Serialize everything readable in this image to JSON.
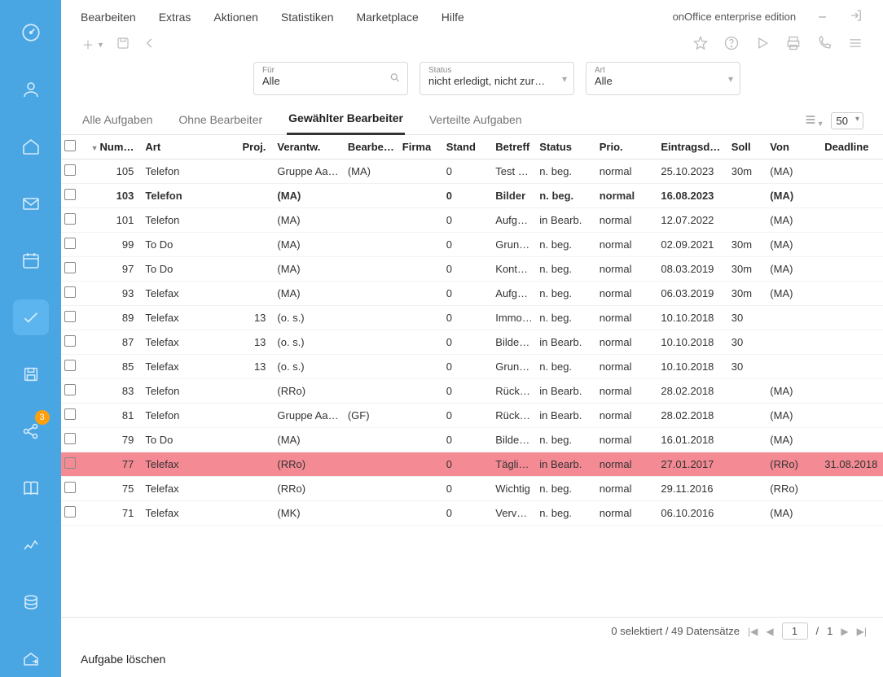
{
  "sidebar": {
    "badge": "3"
  },
  "menubar": {
    "items": [
      "Bearbeiten",
      "Extras",
      "Aktionen",
      "Statistiken",
      "Marketplace",
      "Hilfe"
    ],
    "edition": "onOffice enterprise edition",
    "minimize": "–"
  },
  "filters": {
    "fuer": {
      "label": "Für",
      "value": "Alle"
    },
    "status": {
      "label": "Status",
      "value": "nicht erledigt, nicht zurü…"
    },
    "art": {
      "label": "Art",
      "value": "Alle"
    }
  },
  "tabs": {
    "items": [
      "Alle Aufgaben",
      "Ohne Bearbeiter",
      "Gewählter Bearbeiter",
      "Verteilte Aufgaben"
    ],
    "active": 2,
    "page_size": "50"
  },
  "headers": {
    "num": "Num…",
    "art": "Art",
    "proj": "Proj.",
    "verantw": "Verantw.",
    "bearbei": "Bearbei…",
    "firma": "Firma",
    "stand": "Stand",
    "betreff": "Betreff",
    "status": "Status",
    "prio": "Prio.",
    "eintrag": "Eintragsd…",
    "soll": "Soll",
    "von": "Von",
    "deadline": "Deadline"
  },
  "rows": [
    {
      "num": "105",
      "art": "Telefon",
      "proj": "",
      "ver": "Gruppe Aa…",
      "bearb": "(MA)",
      "firma": "",
      "stand": "0",
      "betr": "Test …",
      "status": "n. beg.",
      "prio": "normal",
      "eint": "25.10.2023",
      "soll": "30m",
      "von": "(MA)",
      "dead": "",
      "bold": false,
      "hl": false
    },
    {
      "num": "103",
      "art": "Telefon",
      "proj": "",
      "ver": "(MA)",
      "bearb": "",
      "firma": "",
      "stand": "0",
      "betr": "Bilder",
      "status": "n. beg.",
      "prio": "normal",
      "eint": "16.08.2023",
      "soll": "",
      "von": "(MA)",
      "dead": "",
      "bold": true,
      "hl": false
    },
    {
      "num": "101",
      "art": "Telefon",
      "proj": "",
      "ver": "(MA)",
      "bearb": "",
      "firma": "",
      "stand": "0",
      "betr": "Aufga…",
      "status": "in Bearb.",
      "prio": "normal",
      "eint": "12.07.2022",
      "soll": "",
      "von": "(MA)",
      "dead": "",
      "bold": false,
      "hl": false
    },
    {
      "num": "99",
      "art": "To Do",
      "proj": "",
      "ver": "(MA)",
      "bearb": "",
      "firma": "",
      "stand": "0",
      "betr": "Grun…",
      "status": "n. beg.",
      "prio": "normal",
      "eint": "02.09.2021",
      "soll": "30m",
      "von": "(MA)",
      "dead": "",
      "bold": false,
      "hl": false
    },
    {
      "num": "97",
      "art": "To Do",
      "proj": "",
      "ver": "(MA)",
      "bearb": "",
      "firma": "",
      "stand": "0",
      "betr": "Konta…",
      "status": "n. beg.",
      "prio": "normal",
      "eint": "08.03.2019",
      "soll": "30m",
      "von": "(MA)",
      "dead": "",
      "bold": false,
      "hl": false
    },
    {
      "num": "93",
      "art": "Telefax",
      "proj": "",
      "ver": "(MA)",
      "bearb": "",
      "firma": "",
      "stand": "0",
      "betr": "Aufga…",
      "status": "n. beg.",
      "prio": "normal",
      "eint": "06.03.2019",
      "soll": "30m",
      "von": "(MA)",
      "dead": "",
      "bold": false,
      "hl": false
    },
    {
      "num": "89",
      "art": "Telefax",
      "proj": "13",
      "ver": "(o. s.)",
      "bearb": "",
      "firma": "",
      "stand": "0",
      "betr": "Immo…",
      "status": "n. beg.",
      "prio": "normal",
      "eint": "10.10.2018",
      "soll": "30",
      "von": "",
      "dead": "",
      "bold": false,
      "hl": false
    },
    {
      "num": "87",
      "art": "Telefax",
      "proj": "13",
      "ver": "(o. s.)",
      "bearb": "",
      "firma": "",
      "stand": "0",
      "betr": "Bilder…",
      "status": "in Bearb.",
      "prio": "normal",
      "eint": "10.10.2018",
      "soll": "30",
      "von": "",
      "dead": "",
      "bold": false,
      "hl": false
    },
    {
      "num": "85",
      "art": "Telefax",
      "proj": "13",
      "ver": "(o. s.)",
      "bearb": "",
      "firma": "",
      "stand": "0",
      "betr": "Grun…",
      "status": "n. beg.",
      "prio": "normal",
      "eint": "10.10.2018",
      "soll": "30",
      "von": "",
      "dead": "",
      "bold": false,
      "hl": false
    },
    {
      "num": "83",
      "art": "Telefon",
      "proj": "",
      "ver": "(RRo)",
      "bearb": "",
      "firma": "",
      "stand": "0",
      "betr": "Rückr…",
      "status": "in Bearb.",
      "prio": "normal",
      "eint": "28.02.2018",
      "soll": "",
      "von": "(MA)",
      "dead": "",
      "bold": false,
      "hl": false
    },
    {
      "num": "81",
      "art": "Telefon",
      "proj": "",
      "ver": "Gruppe Aa…",
      "bearb": "(GF)",
      "firma": "",
      "stand": "0",
      "betr": "Rückr…",
      "status": "in Bearb.",
      "prio": "normal",
      "eint": "28.02.2018",
      "soll": "",
      "von": "(MA)",
      "dead": "",
      "bold": false,
      "hl": false
    },
    {
      "num": "79",
      "art": "To Do",
      "proj": "",
      "ver": "(MA)",
      "bearb": "",
      "firma": "",
      "stand": "0",
      "betr": "Bilder…",
      "status": "n. beg.",
      "prio": "normal",
      "eint": "16.01.2018",
      "soll": "",
      "von": "(MA)",
      "dead": "",
      "bold": false,
      "hl": false
    },
    {
      "num": "77",
      "art": "Telefax",
      "proj": "",
      "ver": "(RRo)",
      "bearb": "",
      "firma": "",
      "stand": "0",
      "betr": "Täglic…",
      "status": "in Bearb.",
      "prio": "normal",
      "eint": "27.01.2017",
      "soll": "",
      "von": "(RRo)",
      "dead": "31.08.2018",
      "bold": false,
      "hl": true
    },
    {
      "num": "75",
      "art": "Telefax",
      "proj": "",
      "ver": "(RRo)",
      "bearb": "",
      "firma": "",
      "stand": "0",
      "betr": "Wichtig",
      "status": "n. beg.",
      "prio": "normal",
      "eint": "29.11.2016",
      "soll": "",
      "von": "(RRo)",
      "dead": "",
      "bold": false,
      "hl": false
    },
    {
      "num": "71",
      "art": "Telefax",
      "proj": "",
      "ver": "(MK)",
      "bearb": "",
      "firma": "",
      "stand": "0",
      "betr": "Verv…",
      "status": "n. beg.",
      "prio": "normal",
      "eint": "06.10.2016",
      "soll": "",
      "von": "(MA)",
      "dead": "",
      "bold": false,
      "hl": false
    }
  ],
  "pager": {
    "status": "0 selektiert / 49 Datensätze",
    "page": "1",
    "sep": "/",
    "total": "1"
  },
  "footer_action": "Aufgabe löschen"
}
